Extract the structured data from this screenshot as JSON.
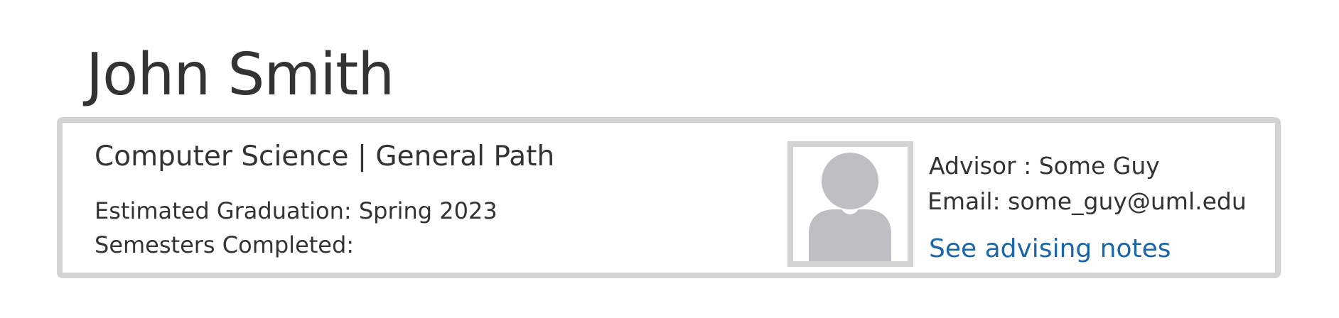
{
  "student": {
    "name": "John Smith"
  },
  "card": {
    "program": "Computer Science | General Path",
    "graduation_line": "Estimated Graduation: Spring 2023",
    "semesters_line": "Semesters Completed:",
    "advisor_line": "Advisor : Some Guy",
    "email_line": "Email: some_guy@uml.edu",
    "notes_link": "See advising notes"
  },
  "colors": {
    "text": "#333333",
    "border": "#d3d3d3",
    "avatar_gray": "#bebfc3",
    "link": "#1a66a8"
  },
  "icons": {
    "avatar": "person-placeholder-icon"
  }
}
